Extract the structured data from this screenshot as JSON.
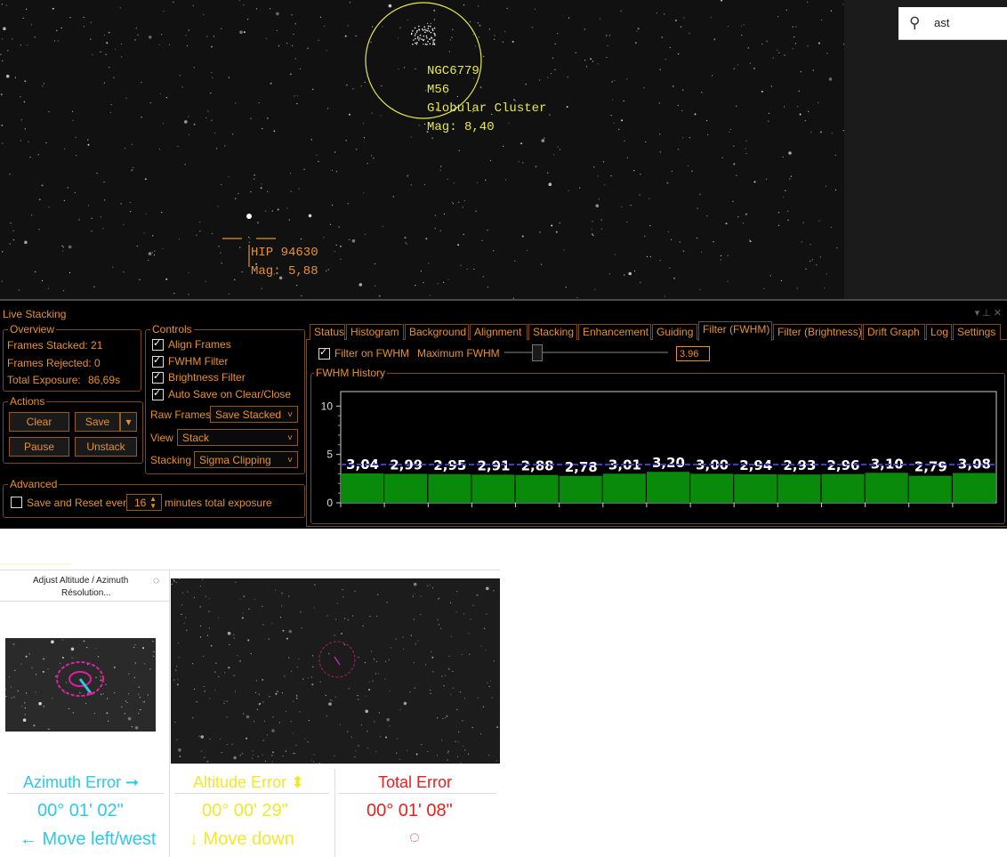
{
  "search": {
    "value": "ast"
  },
  "sky": {
    "target": {
      "lines": [
        "NGC6779",
        "M56",
        "Globular Cluster",
        "Mag: 8,40"
      ]
    },
    "star": {
      "lines": [
        "HIP 94630",
        "Mag: 5,88"
      ]
    }
  },
  "live_stacking": {
    "title": "Live Stacking",
    "window_controls": "▾ ⊥ ✕",
    "overview": {
      "legend": "Overview",
      "frames_stacked": "Frames Stacked:  21",
      "frames_rejected": "Frames Rejected: 0",
      "total_exposure_label": "Total Exposure:",
      "total_exposure_value": "86,69s"
    },
    "actions": {
      "legend": "Actions",
      "clear": "Clear",
      "save": "Save",
      "pause": "Pause",
      "unstack": "Unstack"
    },
    "controls": {
      "legend": "Controls",
      "align_frames": "Align Frames",
      "fwhm_filter": "FWHM Filter",
      "brightness_filter": "Brightness Filter",
      "auto_save": "Auto Save on Clear/Close",
      "raw_frames_label": "Raw Frames",
      "raw_frames_value": "Save Stacked",
      "view_label": "View",
      "view_value": "Stack",
      "stacking_label": "Stacking",
      "stacking_value": "Sigma Clipping"
    },
    "advanced": {
      "legend": "Advanced",
      "save_reset_label": "Save and Reset every",
      "minutes_value": "16",
      "minutes_label": "minutes total exposure"
    },
    "tabs": [
      "Status",
      "Histogram",
      "Background",
      "Alignment",
      "Stacking",
      "Enhancement",
      "Guiding",
      "Filter (FWHM)",
      "Filter (Brightness)",
      "Drift Graph",
      "Log",
      "Settings"
    ],
    "active_tab": "Filter (FWHM)",
    "filter": {
      "filter_on_fwhm": "Filter on FWHM",
      "max_fwhm_label": "Maximum FWHM",
      "max_fwhm_value": "3.96",
      "history_legend": "FWHM History"
    }
  },
  "chart_data": {
    "type": "bar",
    "title": "FWHM History",
    "values": [
      3.04,
      2.99,
      2.95,
      2.91,
      2.88,
      2.78,
      3.01,
      3.2,
      3.0,
      2.94,
      2.93,
      2.96,
      3.1,
      2.79,
      3.08
    ],
    "labels": [
      "3,04",
      "2,99",
      "2,95",
      "2,91",
      "2,88",
      "2,78",
      "3,01",
      "3,20",
      "3,00",
      "2,94",
      "2,93",
      "2,96",
      "3,10",
      "2,79",
      "3,08"
    ],
    "yticks": [
      "10",
      "5",
      "0"
    ],
    "ylim": [
      0,
      11.5
    ],
    "threshold": 3.96,
    "grid": false,
    "colors": {
      "bar": "#0a8a0a",
      "threshold": "#3a3ad8",
      "label": "#ffffff"
    }
  },
  "polar": {
    "header_title": "Adjust Altitude / Azimuth",
    "header_sub": "Résolution...",
    "azimuth": {
      "title": "Azimuth Error ➞",
      "value": "00° 01' 02\"",
      "hint": "← Move left/west",
      "color": "#2ec8e8"
    },
    "altitude": {
      "title": "Altitude Error ⬍",
      "value": "00° 00' 29\"",
      "hint": "↓ Move down",
      "color": "#f0e830"
    },
    "total": {
      "title": "Total Error",
      "value": "00° 01' 08\"",
      "color": "#e82020"
    }
  }
}
